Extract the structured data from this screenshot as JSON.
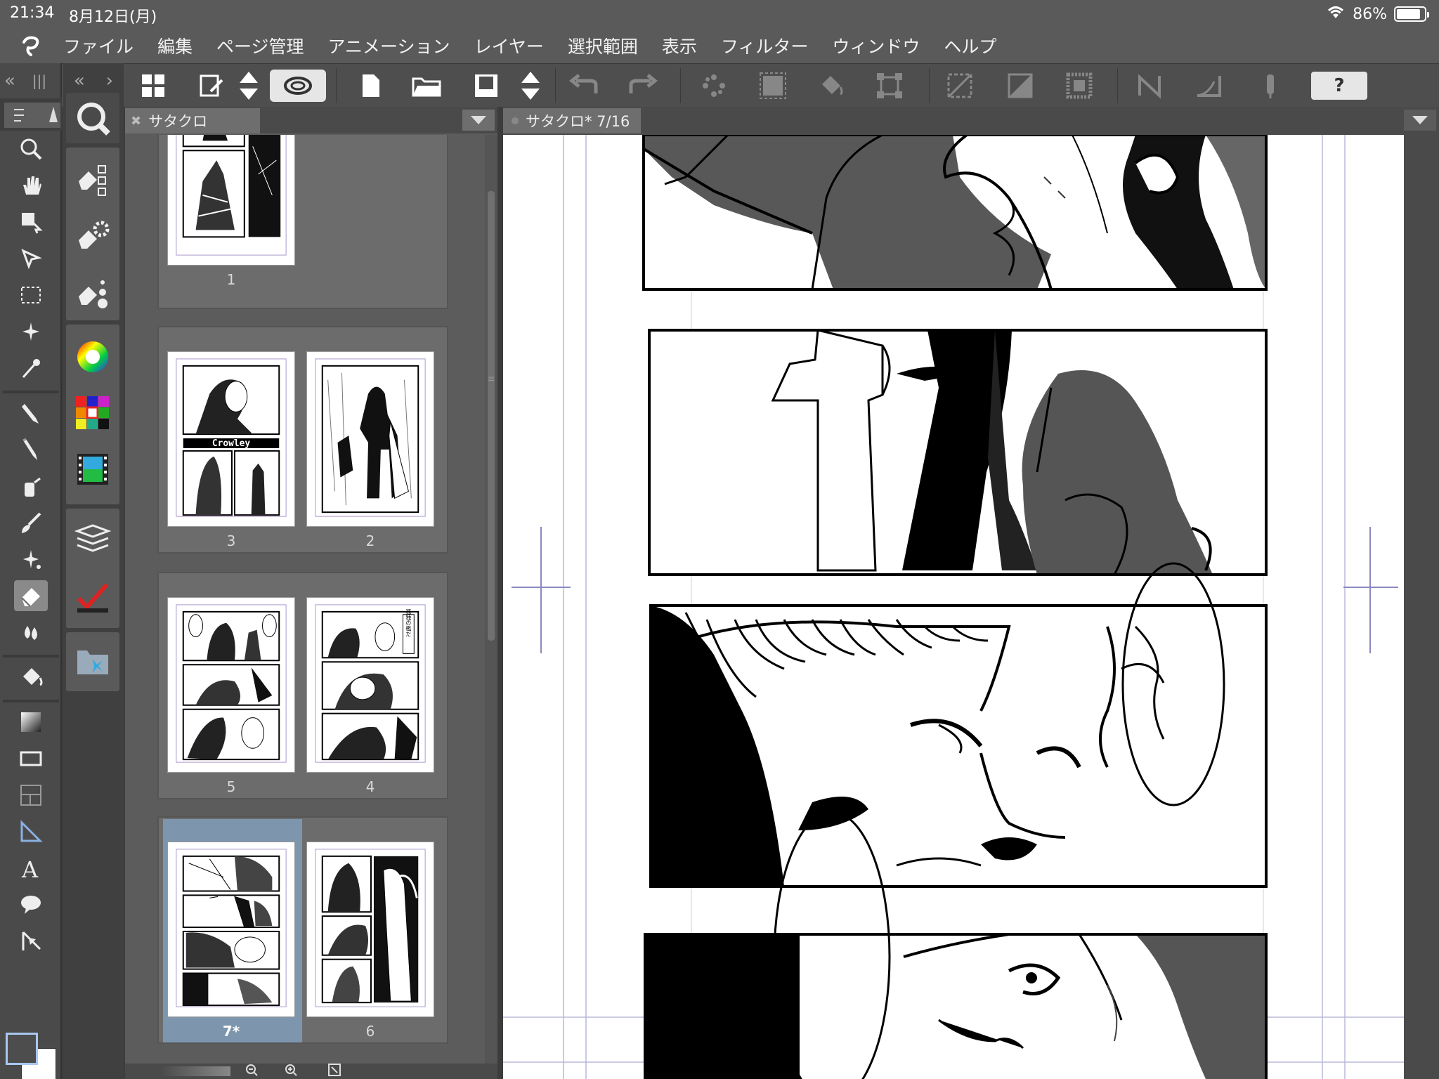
{
  "status": {
    "time": "21:34",
    "date": "8月12日(月)",
    "battery": "86%",
    "battery_level": 0.86
  },
  "menu": [
    "ファイル",
    "編集",
    "ページ管理",
    "アニメーション",
    "レイヤー",
    "選択範囲",
    "表示",
    "フィルター",
    "ウィンドウ",
    "ヘルプ"
  ],
  "toolbar": {
    "help_label": "?"
  },
  "page_panel": {
    "tab_title": "サタクロ",
    "pages": [
      {
        "label": "1"
      },
      {
        "label": "3"
      },
      {
        "label": "2"
      },
      {
        "label": "5"
      },
      {
        "label": "4"
      },
      {
        "label": "7*"
      },
      {
        "label": "6"
      }
    ],
    "thumb_title_text": "Crowley",
    "thumb_vertical_text": "孤独の檻だ"
  },
  "canvas": {
    "tab_title": "サタクロ* 7/16"
  },
  "colors": {
    "chrome": "#5a5a5a",
    "panel": "#5c5c5c",
    "selected": "#7d95ad",
    "foreground": "#4d4d4d",
    "background": "#ffffff"
  }
}
